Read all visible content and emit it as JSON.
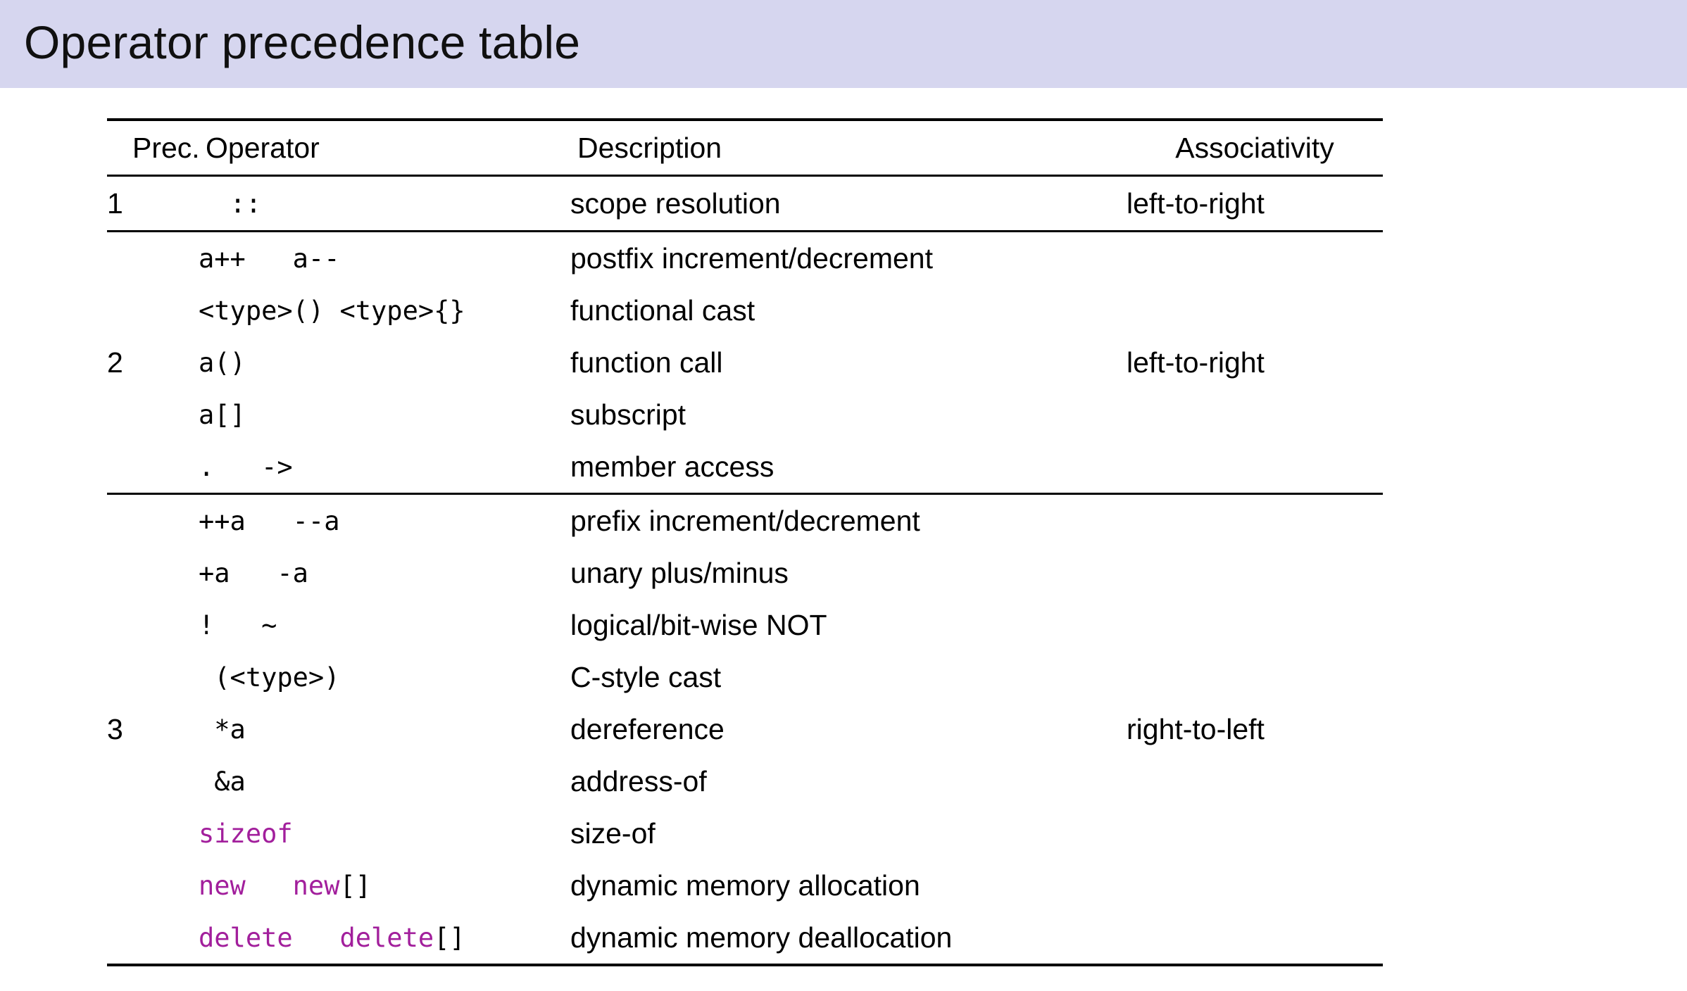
{
  "slide": {
    "title": "Operator precedence table"
  },
  "table": {
    "columns": [
      {
        "key": "prec",
        "label": "Prec."
      },
      {
        "key": "op",
        "label": "Operator"
      },
      {
        "key": "desc",
        "label": "Description"
      },
      {
        "key": "assoc",
        "label": "Associativity"
      }
    ],
    "groups": [
      {
        "prec": "1",
        "assoc": "left-to-right",
        "rows": [
          {
            "op": "  ::",
            "desc": "scope resolution",
            "op_keyword": ""
          }
        ]
      },
      {
        "prec": "2",
        "assoc": "left-to-right",
        "rows": [
          {
            "op": "a++   a--",
            "desc": "postfix increment/decrement",
            "op_keyword": ""
          },
          {
            "op": "<type>() <type>{}",
            "desc": "functional cast",
            "op_keyword": ""
          },
          {
            "op": "a()",
            "desc": "function call",
            "op_keyword": ""
          },
          {
            "op": "a[]",
            "desc": "subscript",
            "op_keyword": ""
          },
          {
            "op": ".   ->",
            "desc": "member access",
            "op_keyword": ""
          }
        ]
      },
      {
        "prec": "3",
        "assoc": "right-to-left",
        "rows": [
          {
            "op": "++a   --a",
            "desc": "prefix increment/decrement",
            "op_keyword": ""
          },
          {
            "op": "+a   -a",
            "desc": "unary plus/minus",
            "op_keyword": ""
          },
          {
            "op": "!   ~",
            "desc": "logical/bit-wise NOT",
            "op_keyword": ""
          },
          {
            "op": " (<type>)",
            "desc": "C-style cast",
            "op_keyword": ""
          },
          {
            "op": " *a",
            "desc": "dereference",
            "op_keyword": ""
          },
          {
            "op": " &a",
            "desc": "address-of",
            "op_keyword": ""
          },
          {
            "op": "sizeof",
            "desc": "size-of",
            "op_keyword": "sizeof"
          },
          {
            "op": "new   new[]",
            "desc": "dynamic memory allocation",
            "op_keyword": "new_new"
          },
          {
            "op": "delete   delete[]",
            "desc": "dynamic memory deallocation",
            "op_keyword": "delete_delete"
          }
        ]
      }
    ]
  },
  "colors": {
    "title_band": "#d6d6ef",
    "keyword": "#a21f9c",
    "text": "#000000",
    "page_background": "#ffffff"
  }
}
